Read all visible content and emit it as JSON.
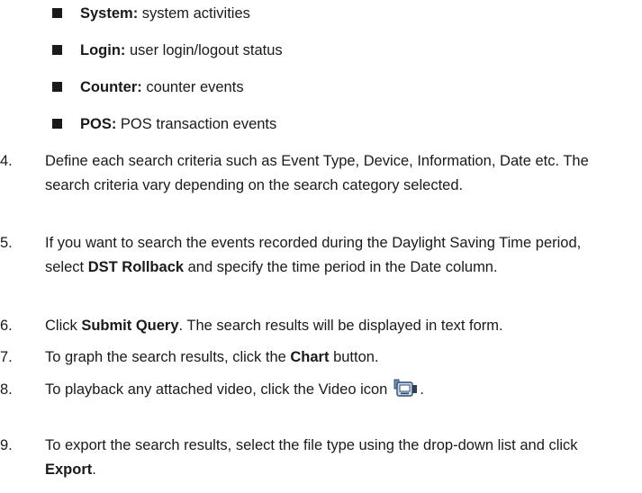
{
  "categories": [
    {
      "term": "System:",
      "desc": " system activities"
    },
    {
      "term": "Login:",
      "desc": " user login/logout status"
    },
    {
      "term": "Counter:",
      "desc": " counter events"
    },
    {
      "term": "POS:",
      "desc": " POS transaction events"
    }
  ],
  "steps": [
    {
      "num": "4.",
      "t1": "Define each search criteria such as Event Type, Device, Information, Date etc. The search criteria vary depending on the search category selected."
    },
    {
      "num": "5.",
      "t1": "If you want to search the events recorded during the Daylight Saving Time period, select ",
      "b1": "DST Rollback",
      "t2": " and specify the time period in the Date column."
    },
    {
      "num": "6.",
      "t1": "Click ",
      "b1": "Submit Query",
      "t2": ". The search results will be displayed in text form."
    },
    {
      "num": "7.",
      "t1": "To graph the search results, click the ",
      "b1": "Chart",
      "t2": " button."
    },
    {
      "num": "8.",
      "t1": "To playback any attached video, click the Video icon",
      "icon": "video-icon",
      "t2": "."
    },
    {
      "num": "9.",
      "t1": "To export the search results, select the file type using the drop-down list and click ",
      "b1": "Export",
      "t2": "."
    }
  ]
}
